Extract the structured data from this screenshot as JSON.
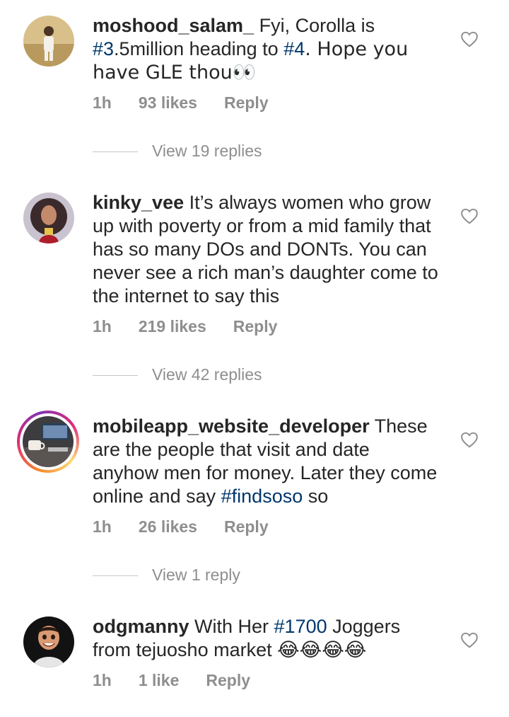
{
  "comments": [
    {
      "username": "moshood_salam_",
      "text_parts": [
        " Fyi, Corolla is ",
        "#3",
        ".5million heading to ",
        "#4",
        ". Hope you have GLE thou👀"
      ],
      "time": "1h",
      "likes": "93 likes",
      "reply": "Reply",
      "view_replies": "View 19 replies"
    },
    {
      "username": "kinky_vee",
      "text": " It’s always women who grow up with poverty or from a mid family that has so many DOs and DONTs. You can never see a rich man’s daughter come to the internet to say this",
      "time": "1h",
      "likes": "219 likes",
      "reply": "Reply",
      "view_replies": "View 42 replies"
    },
    {
      "username": "mobileapp_website_developer",
      "text_parts": [
        " These are the people that visit and date anyhow men for money. Later they come online and say ",
        "#findsoso",
        " so"
      ],
      "time": "1h",
      "likes": "26 likes",
      "reply": "Reply",
      "view_replies": "View 1 reply"
    },
    {
      "username": "odgmanny",
      "text_parts": [
        " With Her ",
        "#1700",
        " Joggers from tejuosho market ",
        "😂😂😂😂"
      ],
      "time": "1h",
      "likes": "1 like",
      "reply": "Reply"
    }
  ],
  "colors": {
    "text": "#262626",
    "meta": "#8e8e8e",
    "hashtag": "#00376b",
    "divider": "#c7c7c7"
  },
  "icons": [
    "heart-outline-icon"
  ]
}
